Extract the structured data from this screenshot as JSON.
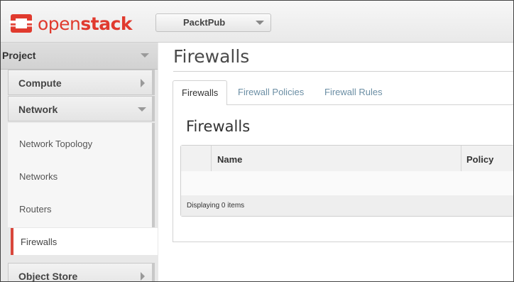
{
  "brand": {
    "name_part1": "open",
    "name_part2": "stack",
    "accent": "#e03a2e"
  },
  "project_selector": {
    "value": "PacktPub"
  },
  "sidebar": {
    "dashboard_label": "Project",
    "panels": [
      {
        "label": "Compute",
        "state": "collapsed"
      },
      {
        "label": "Network",
        "state": "expanded"
      },
      {
        "label": "Object Store",
        "state": "collapsed"
      }
    ],
    "network_items": [
      "Network Topology",
      "Networks",
      "Routers"
    ],
    "active_item": "Firewalls"
  },
  "main": {
    "title": "Firewalls",
    "tabs": [
      {
        "label": "Firewalls",
        "active": true
      },
      {
        "label": "Firewall Policies",
        "active": false
      },
      {
        "label": "Firewall Rules",
        "active": false
      }
    ],
    "table": {
      "title": "Firewalls",
      "columns": [
        "Name",
        "Policy"
      ],
      "rows": [],
      "footer": "Displaying 0 items"
    }
  }
}
